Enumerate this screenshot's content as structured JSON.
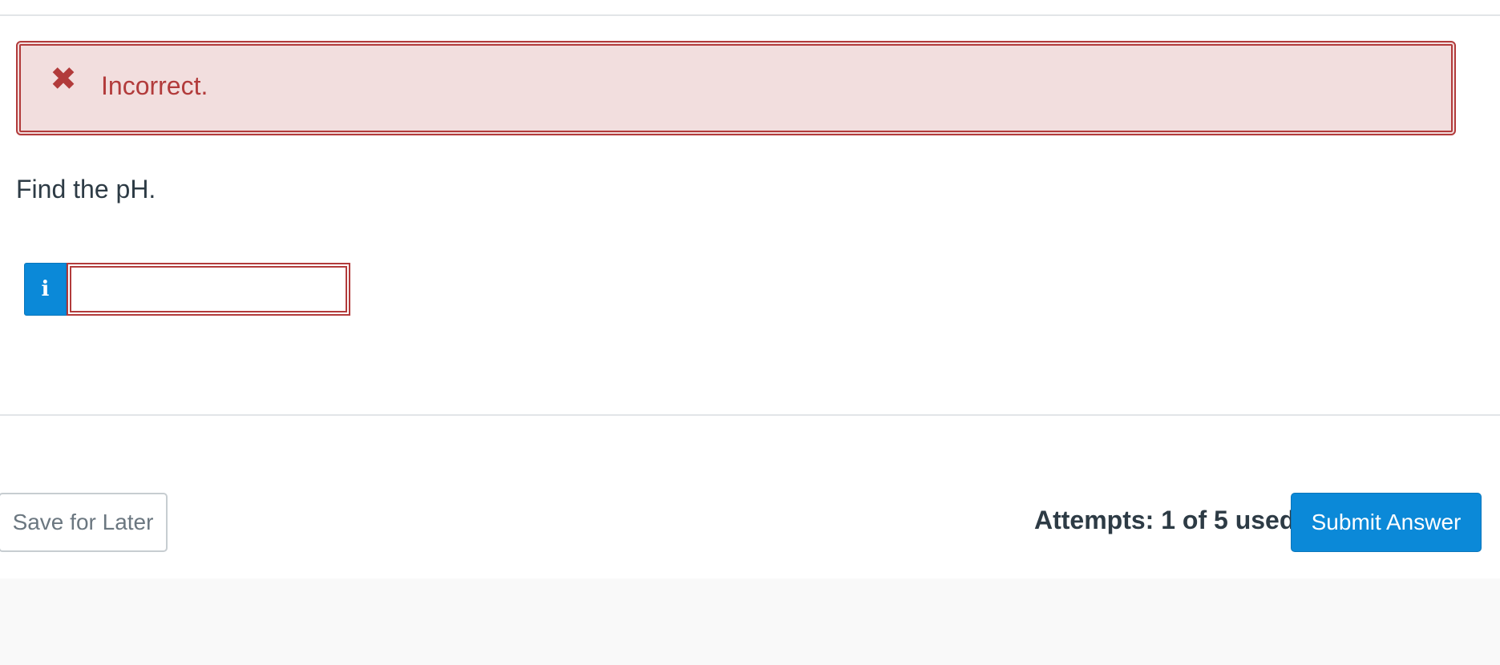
{
  "feedback": {
    "icon": "close-x-icon",
    "icon_glyph": "✖",
    "message": "Incorrect.",
    "color": "#b23b3b",
    "background": "#f2dede"
  },
  "question": {
    "prompt": "Find the pH."
  },
  "answer": {
    "info_icon": "info-icon",
    "info_glyph": "i",
    "value": "",
    "placeholder": ""
  },
  "footer": {
    "save_label": "Save for Later",
    "attempts_text": "Attempts: 1 of 5 used",
    "submit_label": "Submit Answer",
    "accent_color": "#0b89d8"
  }
}
